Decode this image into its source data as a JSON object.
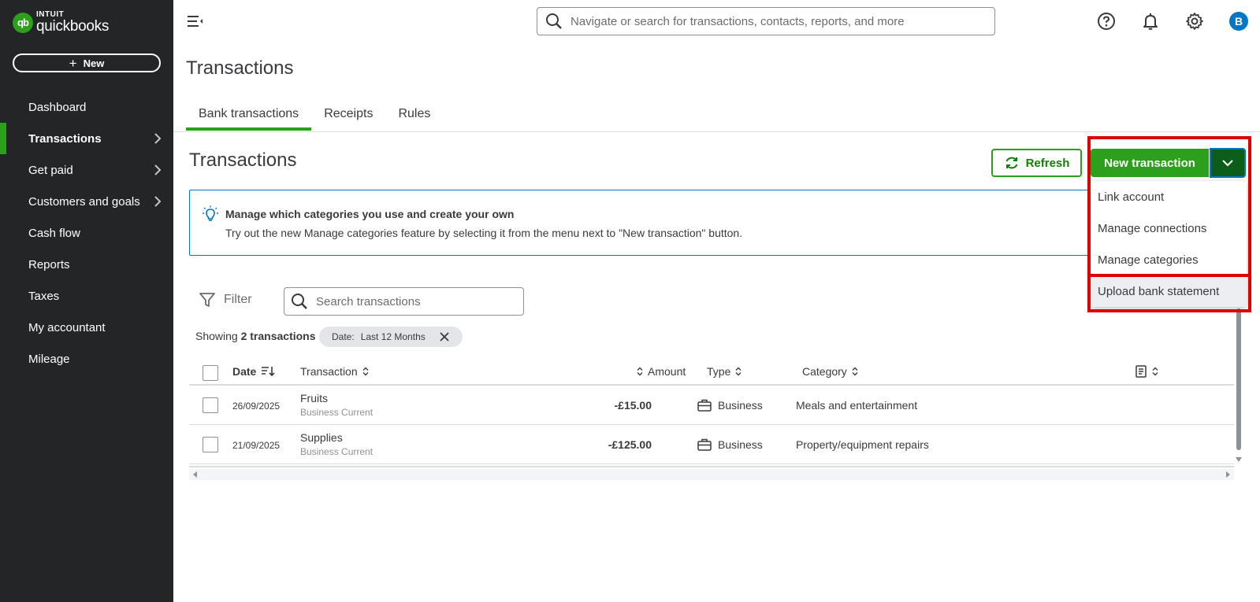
{
  "brand": {
    "intuit": "INTUIT",
    "product": "quickbooks",
    "mark": "qb",
    "color": "#2ca01c"
  },
  "sidebar": {
    "new_label": "New",
    "items": [
      {
        "label": "Dashboard",
        "has_children": false
      },
      {
        "label": "Transactions",
        "has_children": true,
        "active": true
      },
      {
        "label": "Get paid",
        "has_children": true
      },
      {
        "label": "Customers and goals",
        "has_children": true
      },
      {
        "label": "Cash flow",
        "has_children": false
      },
      {
        "label": "Reports",
        "has_children": false
      },
      {
        "label": "Taxes",
        "has_children": false
      },
      {
        "label": "My accountant",
        "has_children": false
      },
      {
        "label": "Mileage",
        "has_children": false
      }
    ]
  },
  "topbar": {
    "search_placeholder": "Navigate or search for transactions, contacts, reports, and more",
    "icons": [
      "help-icon",
      "bell-icon",
      "gear-icon"
    ],
    "avatar_letter": "B"
  },
  "page": {
    "title": "Transactions",
    "tabs": [
      {
        "label": "Bank transactions",
        "active": true
      },
      {
        "label": "Receipts"
      },
      {
        "label": "Rules"
      }
    ],
    "section_title": "Transactions",
    "refresh_label": "Refresh",
    "new_transaction_label": "New transaction"
  },
  "banner": {
    "title": "Manage which categories you use and create your own",
    "body": "Try out the new Manage categories feature by selecting it from the menu next to \"New transaction\" button."
  },
  "dropdown": {
    "items": [
      {
        "label": "Link account"
      },
      {
        "label": "Manage connections"
      },
      {
        "label": "Manage categories"
      },
      {
        "label": "Upload bank statement",
        "highlighted": true
      }
    ]
  },
  "toolbar": {
    "filter_label": "Filter",
    "search_placeholder": "Search transactions",
    "showing_prefix": "Showing ",
    "showing_count": "2 transactions",
    "chip_key": "Date:",
    "chip_value": "Last 12 Months"
  },
  "table": {
    "headers": {
      "date": "Date",
      "transaction": "Transaction",
      "amount": "Amount",
      "type": "Type",
      "category": "Category"
    },
    "rows": [
      {
        "date": "26/09/2025",
        "name": "Fruits",
        "account": "Business Current",
        "amount": "-£15.00",
        "type": "Business",
        "category": "Meals and entertainment"
      },
      {
        "date": "21/09/2025",
        "name": "Supplies",
        "account": "Business Current",
        "amount": "-£125.00",
        "type": "Business",
        "category": "Property/equipment repairs"
      }
    ]
  },
  "colors": {
    "accent_green": "#2ca01c",
    "dark_green": "#0d5d1a",
    "sidebar_bg": "#242526",
    "focus_blue": "#0077c5",
    "highlight_red": "#e00000"
  }
}
